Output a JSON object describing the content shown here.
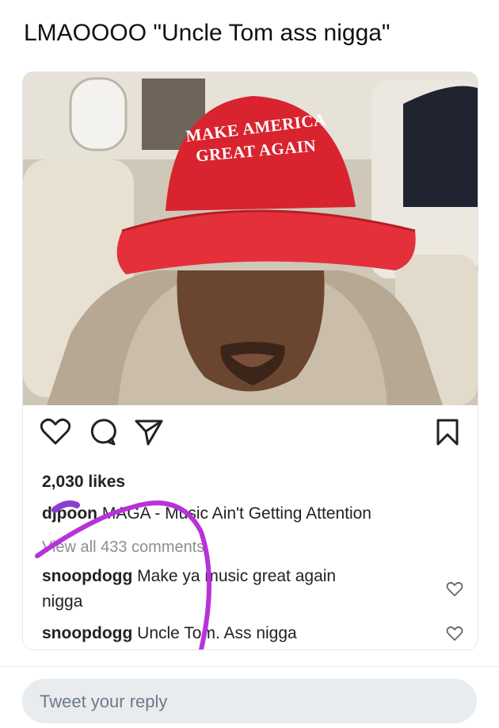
{
  "tweet": {
    "text": "LMAOOOO \"Uncle Tom ass nigga\""
  },
  "post": {
    "hat_text_line1": "MAKE AMERICA",
    "hat_text_line2": "GREAT AGAIN",
    "likes": "2,030 likes",
    "caption": {
      "user": "djpoon",
      "text": "MAGA - Music Ain't Getting Attention"
    },
    "view_all_comments": "View all 433 comments",
    "comments": [
      {
        "user": "snoopdogg",
        "text": "Make ya music great again",
        "text_cont": "nigga"
      },
      {
        "user": "snoopdogg",
        "text": "Uncle Tom. Ass nigga"
      }
    ]
  },
  "reply": {
    "placeholder": "Tweet your reply"
  },
  "colors": {
    "hat_red": "#d9242f",
    "annotation_purple": "#b832d9",
    "link_gray": "#8e8e8e"
  },
  "icons": [
    "heart-icon",
    "comment-icon",
    "share-icon",
    "bookmark-icon",
    "small-heart-icon"
  ]
}
